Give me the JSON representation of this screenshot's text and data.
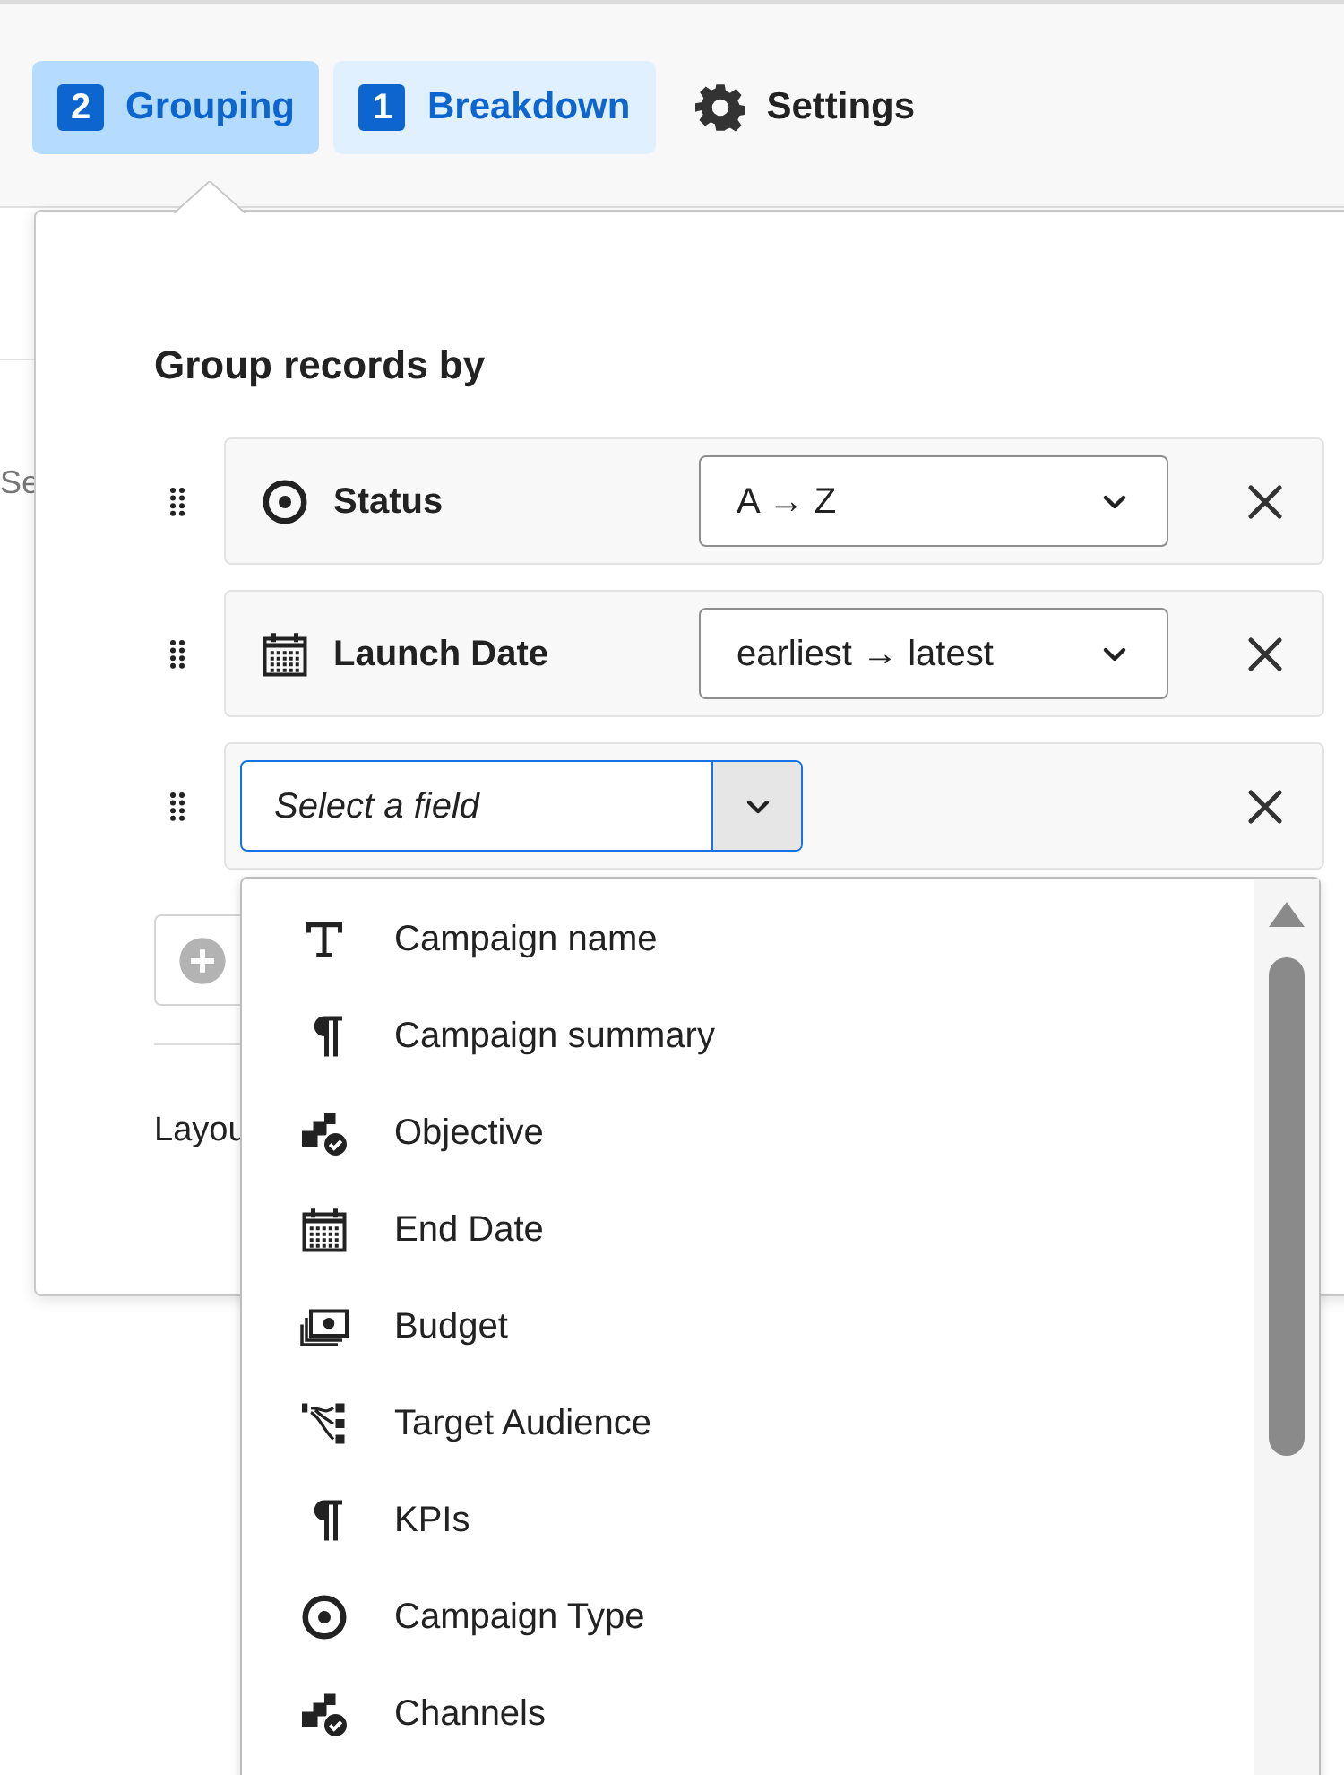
{
  "tabs": [
    {
      "kind": "count",
      "count": "2",
      "label": "Grouping",
      "selected": true
    },
    {
      "kind": "count",
      "count": "1",
      "label": "Breakdown",
      "selected": false
    },
    {
      "kind": "settings",
      "label": "Settings",
      "selected": false
    }
  ],
  "background": {
    "fragment": "Se"
  },
  "popover": {
    "heading": "Group records by",
    "rows": [
      {
        "kind": "single-select",
        "name": "Status",
        "sort": "A → Z"
      },
      {
        "kind": "date",
        "name": "Launch Date",
        "sort": "earliest → latest"
      },
      {
        "kind": "picker",
        "placeholder": "Select a field"
      }
    ],
    "layout_label": "Layou"
  },
  "dropdown": {
    "items": [
      {
        "kind": "text",
        "label": "Campaign name"
      },
      {
        "kind": "paragraph",
        "label": "Campaign summary"
      },
      {
        "kind": "multi-select",
        "label": "Objective"
      },
      {
        "kind": "date",
        "label": "End Date"
      },
      {
        "kind": "currency",
        "label": "Budget"
      },
      {
        "kind": "link",
        "label": "Target Audience"
      },
      {
        "kind": "paragraph",
        "label": "KPIs"
      },
      {
        "kind": "single-select",
        "label": "Campaign Type"
      },
      {
        "kind": "multi-select",
        "label": "Channels"
      }
    ]
  }
}
